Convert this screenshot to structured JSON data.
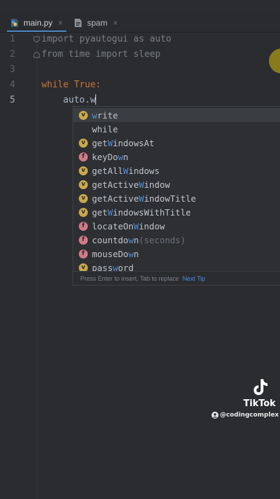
{
  "tabs": [
    {
      "label": "main.py",
      "close": "×",
      "icon": "python-file-icon",
      "active": true
    },
    {
      "label": "spam",
      "close": "×",
      "icon": "text-file-icon",
      "active": false
    }
  ],
  "lines": [
    {
      "n": "1",
      "text": "import pyautogui as auto"
    },
    {
      "n": "2",
      "text": "from time import sleep"
    },
    {
      "n": "3",
      "text": ""
    },
    {
      "n": "4",
      "kw": "while True",
      "rest": ":"
    },
    {
      "n": "5",
      "text": "    auto.w"
    }
  ],
  "completion": {
    "items": [
      {
        "badge": "v",
        "pre": "",
        "hl": "w",
        "post": "rite",
        "arg": ""
      },
      {
        "badge": "",
        "pre": "",
        "hl": "",
        "post": "while",
        "arg": ""
      },
      {
        "badge": "v",
        "pre": "get",
        "hl": "W",
        "post": "indowsAt",
        "arg": ""
      },
      {
        "badge": "f",
        "pre": "keyDo",
        "hl": "w",
        "post": "n",
        "arg": ""
      },
      {
        "badge": "v",
        "pre": "getAll",
        "hl": "W",
        "post": "indows",
        "arg": ""
      },
      {
        "badge": "v",
        "pre": "getActive",
        "hl": "W",
        "post": "indow",
        "arg": ""
      },
      {
        "badge": "v",
        "pre": "getActive",
        "hl": "W",
        "post": "indowTitle",
        "arg": ""
      },
      {
        "badge": "v",
        "pre": "get",
        "hl": "W",
        "post": "indowsWithTitle",
        "arg": ""
      },
      {
        "badge": "f",
        "pre": "locateOn",
        "hl": "W",
        "post": "indow",
        "arg": ""
      },
      {
        "badge": "f",
        "pre": "countdo",
        "hl": "w",
        "post": "n",
        "arg": "(seconds)"
      },
      {
        "badge": "f",
        "pre": "mouseDo",
        "hl": "w",
        "post": "n",
        "arg": ""
      },
      {
        "badge": "v",
        "pre": "pass",
        "hl": "w",
        "post": "ord",
        "arg": ""
      }
    ],
    "footer_hint": "Press Enter to insert, Tab to replace",
    "footer_tip": "Next Tip"
  },
  "watermark": {
    "brand": "TikTok",
    "handle": "@codingcomplex"
  },
  "colors": {
    "keyword": "#cc7832",
    "match_highlight": "#4f8fe0",
    "variable_badge": "#c9a84d",
    "function_badge": "#d27a86"
  }
}
